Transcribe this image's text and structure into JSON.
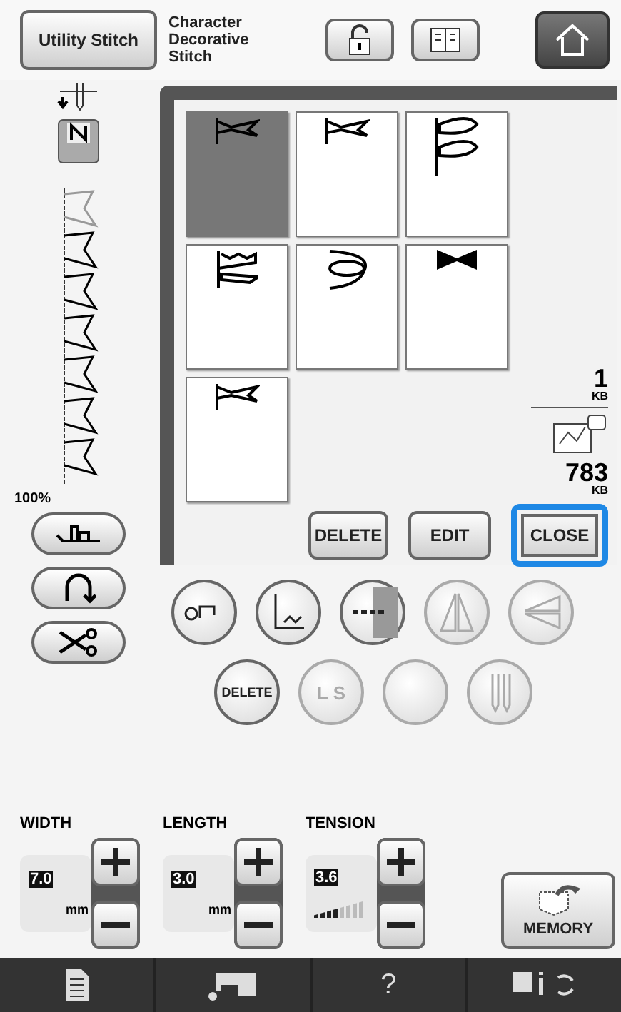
{
  "header": {
    "utility_button": "Utility Stitch",
    "category": "Character Decorative Stitch"
  },
  "left": {
    "zoom": "100%"
  },
  "stitches": [
    {
      "kind": "pennant",
      "selected": true
    },
    {
      "kind": "pennant",
      "selected": false
    },
    {
      "kind": "double",
      "selected": false
    },
    {
      "kind": "wave",
      "selected": false
    },
    {
      "kind": "loop",
      "selected": false
    },
    {
      "kind": "bow",
      "selected": false
    },
    {
      "kind": "pennant",
      "selected": false
    }
  ],
  "memory": {
    "used": "1",
    "used_unit": "KB",
    "free": "783",
    "free_unit": "KB"
  },
  "actions": [
    {
      "label": "DELETE",
      "focused": false
    },
    {
      "label": "EDIT",
      "focused": false
    },
    {
      "label": "CLOSE",
      "focused": true
    }
  ],
  "round_buttons": [
    {
      "kind": "thread",
      "disabled": false
    },
    {
      "kind": "single",
      "disabled": false
    },
    {
      "kind": "repeat",
      "disabled": false
    },
    {
      "kind": "mirror-v",
      "disabled": true
    },
    {
      "kind": "mirror-h",
      "disabled": true
    }
  ],
  "round_buttons_2": [
    {
      "kind": "text",
      "label": "DELETE",
      "disabled": false
    },
    {
      "kind": "text",
      "label": "L S",
      "disabled": true
    },
    {
      "kind": "blank",
      "disabled": true
    },
    {
      "kind": "twin",
      "disabled": true
    }
  ],
  "settings": [
    {
      "kind": "size",
      "label": "WIDTH",
      "value": "7.0",
      "unit": "mm"
    },
    {
      "kind": "size",
      "label": "LENGTH",
      "value": "3.0",
      "unit": "mm"
    },
    {
      "kind": "tension",
      "label": "TENSION",
      "value": "3.6",
      "level": 0.5
    }
  ],
  "memory_button": "MEMORY",
  "bottom_bar": [
    {
      "kind": "page"
    },
    {
      "kind": "machine"
    },
    {
      "kind": "text",
      "label": "?"
    },
    {
      "kind": "info"
    }
  ]
}
